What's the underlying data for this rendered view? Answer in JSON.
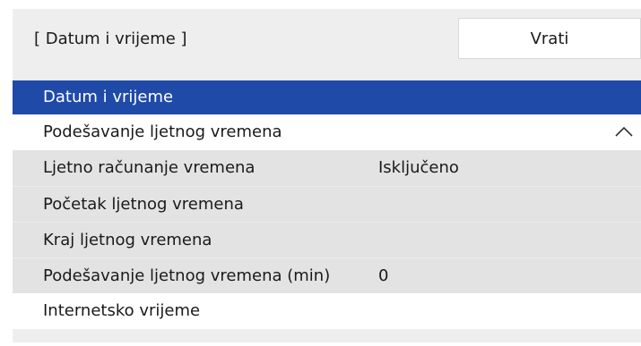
{
  "header": {
    "title": "[ Datum i vrijeme ]",
    "back_label": "Vrati"
  },
  "menu": {
    "items": [
      {
        "label": "Datum i vrijeme",
        "state": "selected"
      },
      {
        "label": "Podešavanje ljetnog vremena",
        "expanded_icon": "chevron-up-icon"
      },
      {
        "label": "Ljetno računanje vremena",
        "value": "Isključeno"
      },
      {
        "label": "Početak ljetnog vremena"
      },
      {
        "label": "Kraj ljetnog vremena"
      },
      {
        "label": "Podešavanje ljetnog vremena (min)",
        "value": "0"
      },
      {
        "label": "Internetsko vrijeme"
      }
    ]
  },
  "colors": {
    "selection": "#1f4aa8",
    "panel": "#eeeeee",
    "submenu": "#e3e3e3"
  }
}
